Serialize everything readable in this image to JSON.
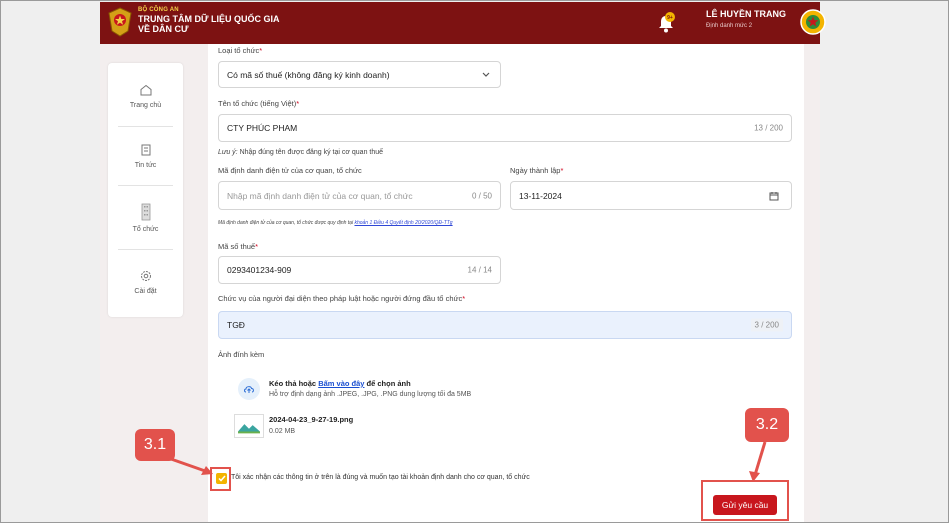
{
  "header": {
    "brand_top": "BỘ CÔNG AN",
    "brand_line1": "TRUNG TÂM DỮ LIỆU QUỐC GIA",
    "brand_line2": "VỀ DÂN CƯ",
    "user_name": "LÊ HUYỀN TRANG",
    "user_level": "Định danh mức 2",
    "bell_badge": "9+"
  },
  "sidebar": {
    "items": [
      {
        "label": "Trang chủ",
        "icon": "home-icon"
      },
      {
        "label": "Tin tức",
        "icon": "news-icon"
      },
      {
        "label": "Tổ chức",
        "icon": "building-icon"
      },
      {
        "label": "Cài đặt",
        "icon": "gear-icon"
      }
    ]
  },
  "form": {
    "org_type": {
      "label": "Loại tổ chức",
      "value": "Có mã số thuế (không đăng ký kinh doanh)"
    },
    "org_name": {
      "label": "Tên tổ chức (tiếng Việt)",
      "value": "CTY PHÚC PHAM",
      "count": "13 / 200"
    },
    "note": {
      "label": "Lưu ý:",
      "text": "Nhập đúng tên được đăng ký tại cơ quan thuế"
    },
    "agency_id": {
      "label": "Mã định danh điện tử của cơ quan, tổ chức",
      "placeholder": "Nhập mã định danh điện tử của cơ quan, tổ chức",
      "count": "0 / 50"
    },
    "founded": {
      "label": "Ngày thành lập",
      "value": "13-11-2024"
    },
    "agency_hint": {
      "text": "Mã định danh điện tử của cơ quan, tổ chức được quy định tại ",
      "link": "khoản 1 Điều 4 Quyết định 20/2020/QĐ-TTg"
    },
    "tax_code": {
      "label": "Mã số thuế",
      "value": "0293401234-909",
      "count": "14 / 14"
    },
    "position": {
      "label": "Chức vụ của người đại diện theo pháp luật hoặc người đứng đầu tổ chức",
      "value": "TGĐ",
      "count": "3 / 200"
    },
    "attachment": {
      "label": "Ảnh đính kèm",
      "drag_text": "Kéo thả hoặc ",
      "browse_link": "Bấm vào đây",
      "drag_suffix": " để chọn ảnh",
      "support": "Hỗ trợ định dạng ảnh .JPEG, .JPG, .PNG dung lượng tối đa 5MB",
      "file_name": "2024-04-23_9-27-19.png",
      "file_size": "0.02 MB"
    },
    "confirm_text": "Tôi xác nhận các thông tin ở trên là đúng và muốn tạo tài khoản định danh cho cơ quan, tổ chức",
    "submit_label": "Gửi yêu cầu"
  },
  "callouts": {
    "step1": "3.1",
    "step2": "3.2"
  },
  "colors": {
    "header": "#7d1212",
    "accent": "#c8161d",
    "callout": "#e2524c",
    "checkbox": "#f3b400"
  }
}
